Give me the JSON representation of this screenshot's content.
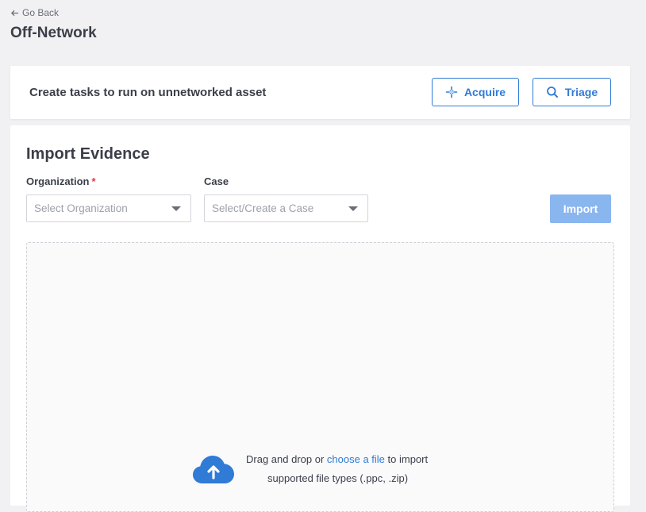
{
  "nav": {
    "back_label": "Go Back"
  },
  "page": {
    "title": "Off-Network"
  },
  "task_card": {
    "text": "Create tasks to run on unnetworked asset",
    "acquire_label": "Acquire",
    "triage_label": "Triage"
  },
  "import": {
    "title": "Import Evidence",
    "organization_label": "Organization",
    "required_marker": "*",
    "organization_placeholder": "Select Organization",
    "case_label": "Case",
    "case_placeholder": "Select/Create a Case",
    "import_button": "Import",
    "dropzone": {
      "prefix": "Drag and drop or",
      "link": "choose a file",
      "suffix": "to import",
      "types_hint": "supported file types (.ppc, .zip)"
    }
  },
  "colors": {
    "accent": "#2f7bd6",
    "import_button_disabled": "#8ab6f0",
    "required": "#e0383e"
  },
  "icons": {
    "back": "arrow-left-icon",
    "acquire": "crosshair-sparkle-icon",
    "triage": "search-icon",
    "upload": "cloud-upload-icon"
  }
}
